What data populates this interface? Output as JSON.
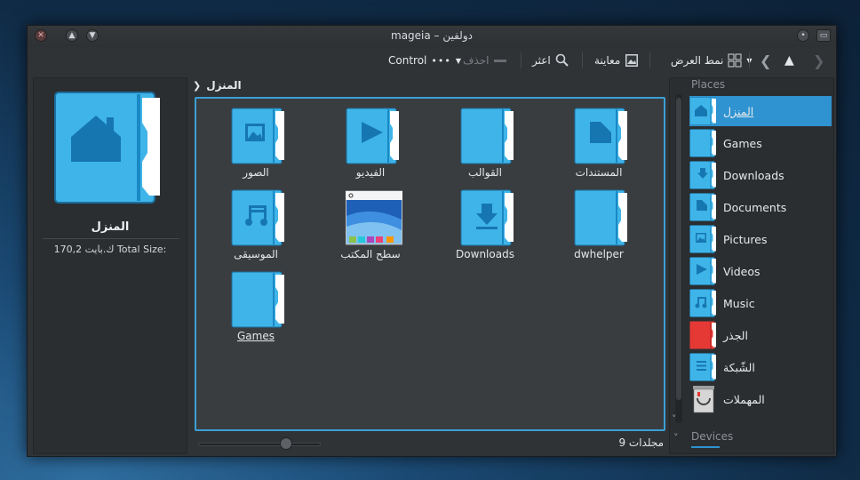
{
  "window": {
    "title": "mageia – دولفين"
  },
  "toolbar": {
    "control_label": "Control",
    "delete_label": "احذف",
    "find_label": "اعثر",
    "preview_label": "معاينة",
    "view_mode_label": "نمط العرض"
  },
  "info_panel": {
    "name": "المنزل",
    "size_text": "170,2 ك.بايت  Total Size:"
  },
  "breadcrumb": {
    "current": "المنزل"
  },
  "items": [
    {
      "label": "الصور",
      "icon": "pictures-icon"
    },
    {
      "label": "الفيديو",
      "icon": "video-icon"
    },
    {
      "label": "القوالب",
      "icon": "folder-icon"
    },
    {
      "label": "المستندات",
      "icon": "documents-icon"
    },
    {
      "label": "الموسيقى",
      "icon": "music-icon"
    },
    {
      "label": "سطح المكتب",
      "icon": "desktop-icon"
    },
    {
      "label": "Downloads",
      "icon": "download-icon"
    },
    {
      "label": "dwhelper",
      "icon": "folder-icon"
    },
    {
      "label": "Games",
      "icon": "folder-icon"
    }
  ],
  "status": {
    "text": "9 مجلدات"
  },
  "places": {
    "header": "Places",
    "devices_header": "Devices",
    "items": [
      {
        "label": "المنزل",
        "icon": "home-icon"
      },
      {
        "label": "Games",
        "icon": "folder-icon"
      },
      {
        "label": "Downloads",
        "icon": "download-icon"
      },
      {
        "label": "Documents",
        "icon": "documents-icon"
      },
      {
        "label": "Pictures",
        "icon": "pictures-icon"
      },
      {
        "label": "Videos",
        "icon": "video-icon"
      },
      {
        "label": "Music",
        "icon": "music-icon"
      },
      {
        "label": "الجذر",
        "icon": "root-folder-icon"
      },
      {
        "label": "الشّبكة",
        "icon": "network-icon"
      },
      {
        "label": "المهملات",
        "icon": "trash-icon"
      }
    ]
  },
  "colors": {
    "accent": "#2f93d1",
    "folder": "#3fb4e8",
    "folder_dark": "#1677b0"
  }
}
